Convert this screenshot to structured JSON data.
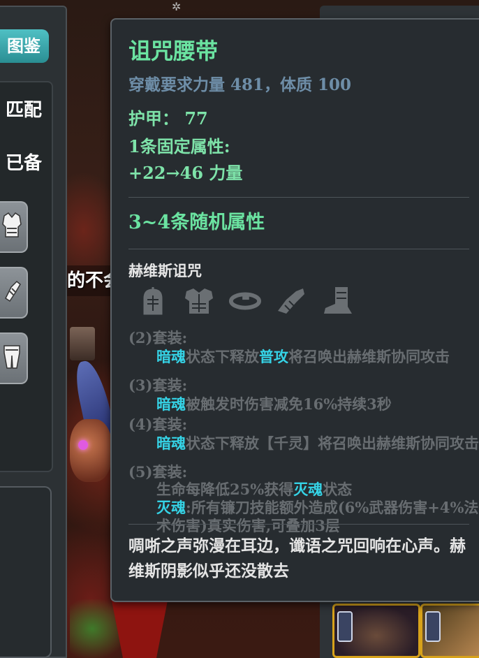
{
  "background": {
    "banner_text": "的不会"
  },
  "left_panel": {
    "tab_label": "图鉴",
    "filter_rows": [
      "匹配",
      "已备"
    ],
    "slot_icons": [
      "chest-armor-icon",
      "gauntlet-icon",
      "leg-armor-icon"
    ]
  },
  "tooltip": {
    "title": "诅咒腰带",
    "requirement": "穿戴要求力量 481，体质 100",
    "armor_line": "护甲：  77",
    "fixed_attr_header": "1条固定属性:",
    "fixed_attr_value": "+22→46  力量",
    "random_attr": "3~4条随机属性",
    "set_name": "赫维斯诅咒",
    "set_icons": [
      "helmet-icon",
      "chest-armor-icon",
      "belt-icon",
      "gauntlet-icon",
      "boots-icon"
    ],
    "set_bonuses": [
      {
        "head": "(2)套装:",
        "lines": [
          [
            {
              "t": "暗魂",
              "h": true
            },
            {
              "t": "状态下释放",
              "h": false
            },
            {
              "t": "普攻",
              "h": true
            },
            {
              "t": "将召唤出赫维斯协同攻击",
              "h": false
            }
          ]
        ]
      },
      {
        "head": "(3)套装:",
        "lines": [
          [
            {
              "t": "暗魂",
              "h": true
            },
            {
              "t": "被触发时伤害减免16%持续3秒",
              "h": false
            }
          ]
        ]
      },
      {
        "head": "(4)套装:",
        "lines": [
          [
            {
              "t": "暗魂",
              "h": true
            },
            {
              "t": "状态下释放【千灵】将召唤出赫维斯协同攻击",
              "h": false
            }
          ]
        ]
      },
      {
        "head": "(5)套装:",
        "lines": [
          [
            {
              "t": "生命每降低25%获得",
              "h": false
            },
            {
              "t": "灭魂",
              "h": true
            },
            {
              "t": "状态",
              "h": false
            }
          ],
          [
            {
              "t": "灭魂",
              "h": true
            },
            {
              "t": ":所有镰刀技能额外造成(6%武器伤害+4%法术伤害)真实伤害,可叠加3层",
              "h": false
            }
          ]
        ]
      }
    ],
    "flavor_text": "啁哳之声弥漫在耳边，谶语之咒回响在心声。赫维斯阴影似乎还没散去"
  },
  "colors": {
    "title_green": "#6be3a1",
    "highlight_cyan": "#35d3e6",
    "muted_text": "#686d71",
    "requirement_blue": "#6e8ea8",
    "tab_teal": "#4fc0c4",
    "slot_gold_border": "#d7a21b"
  }
}
